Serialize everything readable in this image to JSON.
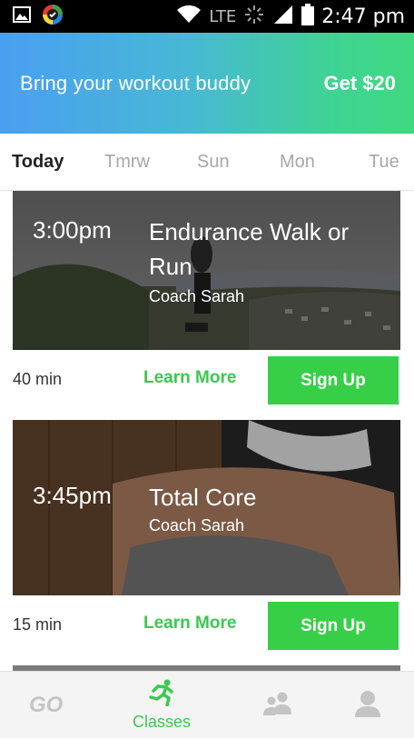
{
  "status_bar": {
    "network": "LTE",
    "time": "2:47 pm",
    "icons": [
      "image-icon",
      "colorful-app-icon",
      "wifi-icon",
      "signal-icon",
      "battery-icon"
    ]
  },
  "promo": {
    "text": "Bring your workout buddy",
    "cta": "Get $20",
    "gradient_start": "#4a9ff0",
    "gradient_end": "#3fd87f"
  },
  "day_tabs": [
    {
      "label": "Today",
      "active": true
    },
    {
      "label": "Tmrw",
      "active": false
    },
    {
      "label": "Sun",
      "active": false
    },
    {
      "label": "Mon",
      "active": false
    },
    {
      "label": "Tue",
      "active": false
    }
  ],
  "classes": [
    {
      "time": "3:00pm",
      "title": "Endurance Walk or Run",
      "coach": "Coach Sarah",
      "duration": "40 min",
      "learn_more": "Learn More",
      "sign_up": "Sign Up"
    },
    {
      "time": "3:45pm",
      "title": "Total Core",
      "coach": "Coach Sarah",
      "duration": "15 min",
      "learn_more": "Learn More",
      "sign_up": "Sign Up"
    }
  ],
  "bottom_nav": [
    {
      "icon": "go-logo-icon",
      "label": ""
    },
    {
      "icon": "running-person-icon",
      "label": "Classes",
      "active": true
    },
    {
      "icon": "people-icon",
      "label": ""
    },
    {
      "icon": "profile-icon",
      "label": ""
    }
  ],
  "colors": {
    "accent_green": "#37cf48",
    "text_green": "#3cc84f",
    "inactive_tab": "#a7a7a7"
  }
}
